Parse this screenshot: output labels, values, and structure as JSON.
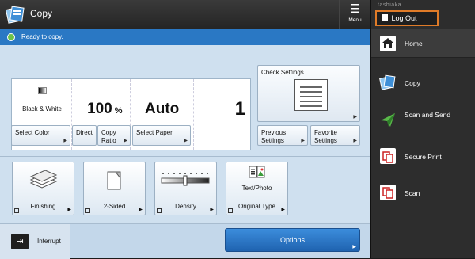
{
  "header": {
    "title": "Copy",
    "menu_label": "Menu"
  },
  "status": {
    "text": "Ready to copy."
  },
  "readout": {
    "color_mode": "Black & White",
    "ratio": "100",
    "ratio_unit": "%",
    "paper": "Auto",
    "copies": "1"
  },
  "buttons": {
    "select_color": "Select Color",
    "direct": "Direct",
    "copy_ratio_1": "Copy",
    "copy_ratio_2": "Ratio",
    "select_paper": "Select Paper",
    "check_settings": "Check Settings",
    "prev_1": "Previous",
    "prev_2": "Settings",
    "fav_1": "Favorite",
    "fav_2": "Settings"
  },
  "functions": {
    "finishing": "Finishing",
    "two_sided": "2-Sided",
    "density": "Density",
    "original_type": "Original Type",
    "original_type_value": "Text/Photo"
  },
  "bottom": {
    "interrupt": "Interrupt",
    "options": "Options"
  },
  "sidebar": {
    "user": "tashiaka",
    "logout": "Log Out",
    "items": [
      {
        "label": "Home"
      },
      {
        "label": "Copy"
      },
      {
        "label": "Scan and Send"
      },
      {
        "label": "Secure Print"
      },
      {
        "label": "Scan"
      }
    ]
  },
  "colors": {
    "status_bar": "#2a78c4",
    "options_button": "#2b77c8",
    "logout_border": "#e07b28",
    "sidebar_bg": "#2d2d2d"
  }
}
